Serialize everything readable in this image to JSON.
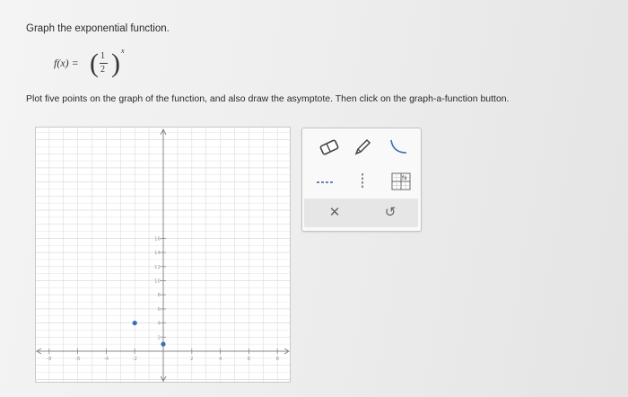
{
  "prompt": {
    "line1": "Graph the exponential function.",
    "line2": "Plot five points on the graph of the function, and also draw the asymptote. Then click on the graph-a-function button."
  },
  "formula": {
    "lhs": "f(x) =",
    "numerator": "1",
    "denominator": "2",
    "exponent": "x"
  },
  "graph": {
    "x_ticks": [
      "-8",
      "-6",
      "-4",
      "-2",
      "2",
      "4",
      "6",
      "8"
    ],
    "y_ticks": [
      "16",
      "14",
      "12",
      "10",
      "8",
      "6",
      "4",
      "2"
    ],
    "plotted_points": [
      {
        "x": -2,
        "y": 4
      },
      {
        "x": 0,
        "y": 1
      }
    ],
    "colors": {
      "point": "#3a6fb5",
      "grid": "#dcdcdc",
      "axis": "#888888"
    }
  },
  "toolbox": {
    "tools": [
      "eraser-icon",
      "pencil-icon",
      "curve-icon",
      "dashed-line-icon",
      "vertical-dashed-line-icon",
      "graph-a-function-icon"
    ],
    "actions": {
      "clear": "✕",
      "undo": "↺"
    }
  }
}
